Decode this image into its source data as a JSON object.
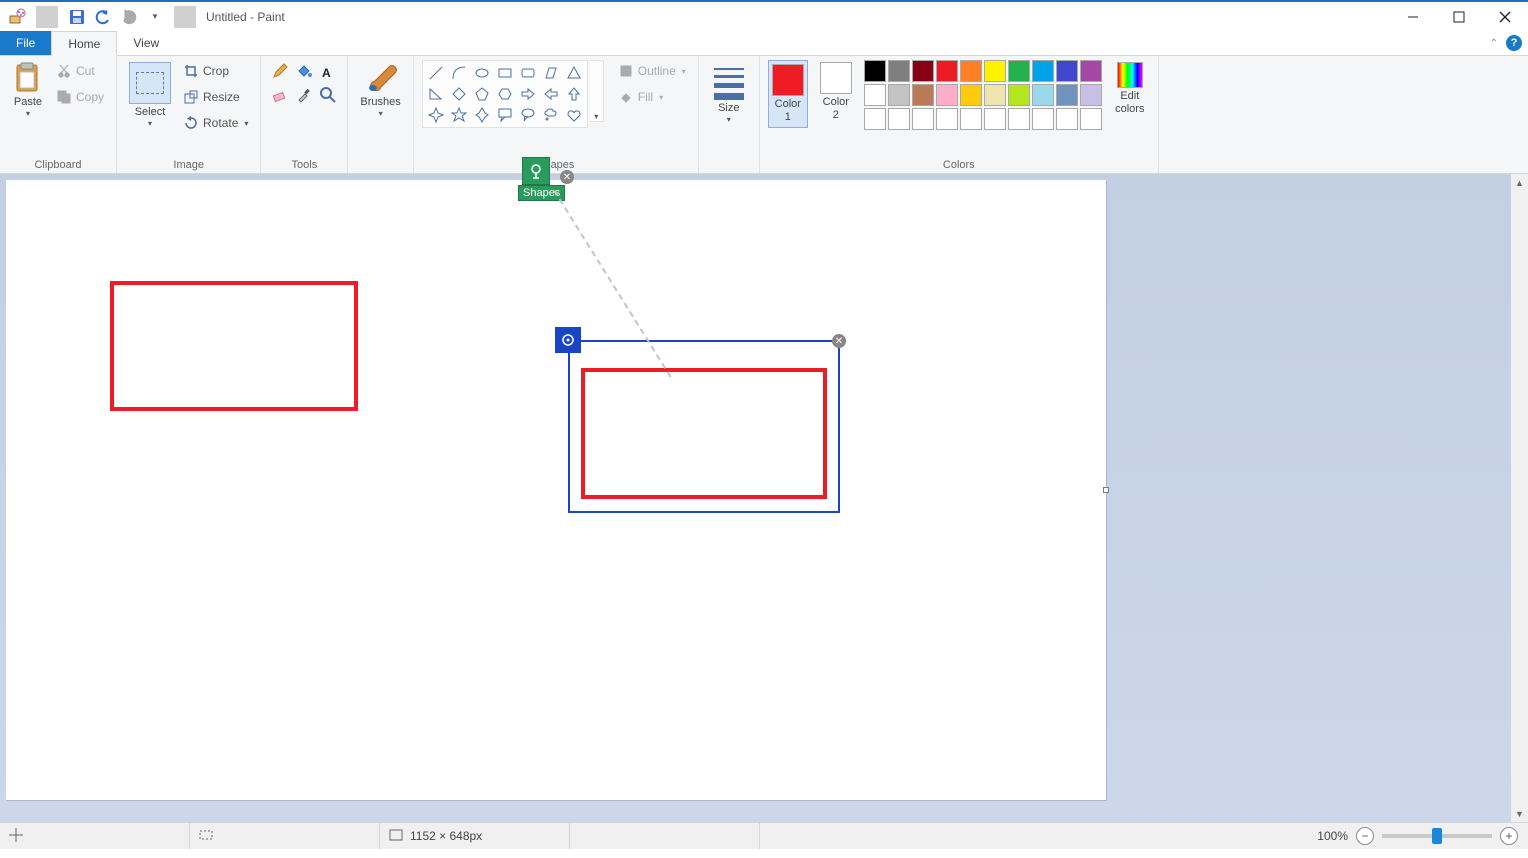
{
  "title": "Untitled - Paint",
  "tabs": {
    "file": "File",
    "home": "Home",
    "view": "View"
  },
  "clipboard": {
    "paste": "Paste",
    "cut": "Cut",
    "copy": "Copy",
    "group": "Clipboard"
  },
  "image": {
    "select": "Select",
    "crop": "Crop",
    "resize": "Resize",
    "rotate": "Rotate",
    "group": "Image"
  },
  "tools": {
    "group": "Tools"
  },
  "brushes": {
    "label": "Brushes"
  },
  "shapes": {
    "outline": "Outline",
    "fill": "Fill",
    "group": "Shapes"
  },
  "size": {
    "label": "Size"
  },
  "colors": {
    "color1": "Color\n1",
    "color2": "Color\n2",
    "edit": "Edit\ncolors",
    "group": "Colors",
    "color1_value": "#ee1c25",
    "color2_value": "#ffffff",
    "palette_row1": [
      "#000000",
      "#7f7f7f",
      "#880015",
      "#ed1c24",
      "#ff7f27",
      "#fff200",
      "#22b14c",
      "#00a2e8",
      "#3f48cc",
      "#a349a4"
    ],
    "palette_row2": [
      "#ffffff",
      "#c3c3c3",
      "#b97a57",
      "#ffaec9",
      "#ffc90e",
      "#efe4b0",
      "#b5e61d",
      "#99d9ea",
      "#7092be",
      "#c8bfe7"
    ],
    "palette_row3": [
      "#ffffff",
      "#ffffff",
      "#ffffff",
      "#ffffff",
      "#ffffff",
      "#ffffff",
      "#ffffff",
      "#ffffff",
      "#ffffff",
      "#ffffff"
    ]
  },
  "status": {
    "canvas_size": "1152 × 648px",
    "zoom": "100%"
  },
  "annotation": {
    "label": "Shapes"
  }
}
